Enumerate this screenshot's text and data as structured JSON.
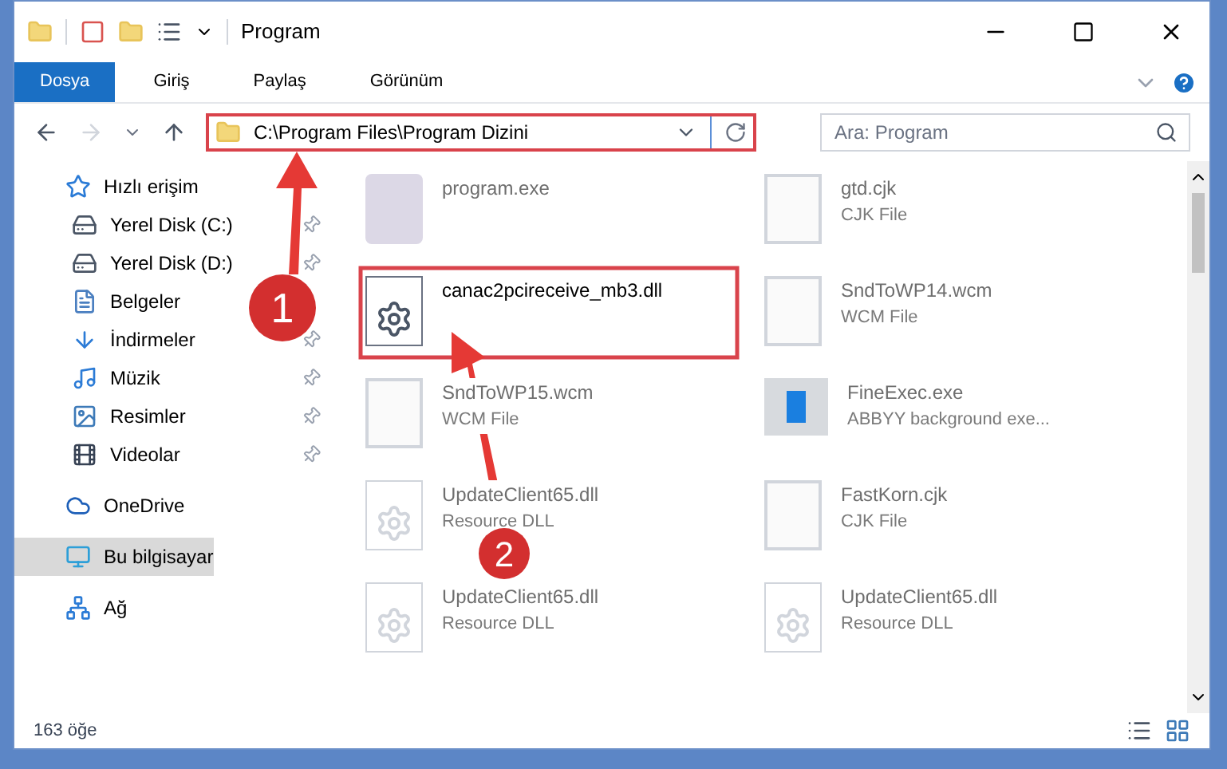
{
  "window": {
    "title": "Program"
  },
  "ribbon_tabs": [
    {
      "label": "Dosya",
      "selected": true
    },
    {
      "label": "Giriş",
      "selected": false
    },
    {
      "label": "Paylaş",
      "selected": false
    },
    {
      "label": "Görünüm",
      "selected": false
    }
  ],
  "address": {
    "path": "C:\\Program Files\\Program Dizini"
  },
  "search": {
    "placeholder": "Ara: Program"
  },
  "sidebar": {
    "items": [
      {
        "label": "Hızlı erişim",
        "kind": "star",
        "selected": false,
        "children": [
          {
            "label": "Yerel Disk (C:)",
            "kind": "drive",
            "pinned": true
          },
          {
            "label": "Yerel Disk (D:)",
            "kind": "drive",
            "pinned": true
          },
          {
            "label": "Belgeler",
            "kind": "doc"
          },
          {
            "label": "İndirmeler",
            "kind": "download",
            "pinned": true
          },
          {
            "label": "Müzik",
            "kind": "music",
            "pinned": true
          },
          {
            "label": "Resimler",
            "kind": "image",
            "pinned": true
          },
          {
            "label": "Videolar",
            "kind": "video",
            "pinned": true
          }
        ]
      },
      {
        "label": "OneDrive",
        "kind": "cloud",
        "selected": false
      },
      {
        "label": "Bu bilgisayar",
        "kind": "monitor",
        "selected": true
      },
      {
        "label": "Ağ",
        "kind": "network",
        "selected": false
      }
    ]
  },
  "files": [
    {
      "name": "program.exe",
      "kind": "app",
      "highlighted": false
    },
    {
      "name": "gtd.cjk",
      "type": "CJK File",
      "kind": "blank",
      "highlighted": false
    },
    {
      "name": "canac2pcireceive_mb3.dll",
      "kind": "gears",
      "highlighted": true
    },
    {
      "name": "SndToWP14.wcm",
      "type": "WCM File",
      "kind": "blank",
      "highlighted": false
    },
    {
      "name": "SndToWP15.wcm",
      "type": "WCM File",
      "kind": "blank",
      "highlighted": false
    },
    {
      "name": "FineExec.exe",
      "type": "ABBYY background exe...",
      "kind": "window",
      "highlighted": false
    },
    {
      "name": "UpdateClient65.dll",
      "type": "Resource DLL",
      "kind": "gears",
      "highlighted": false
    },
    {
      "name": "FastKorn.cjk",
      "type": "CJK File",
      "kind": "blank",
      "highlighted": false
    },
    {
      "name": "UpdateClient65.dll",
      "type": "Resource DLL",
      "kind": "gears",
      "highlighted": false
    },
    {
      "name": "UpdateClient65.dll",
      "type": "Resource DLL",
      "kind": "gears",
      "highlighted": false
    }
  ],
  "status_bar": {
    "count": "163 öğe"
  },
  "callouts": [
    {
      "number": "1"
    },
    {
      "number": "2"
    }
  ]
}
